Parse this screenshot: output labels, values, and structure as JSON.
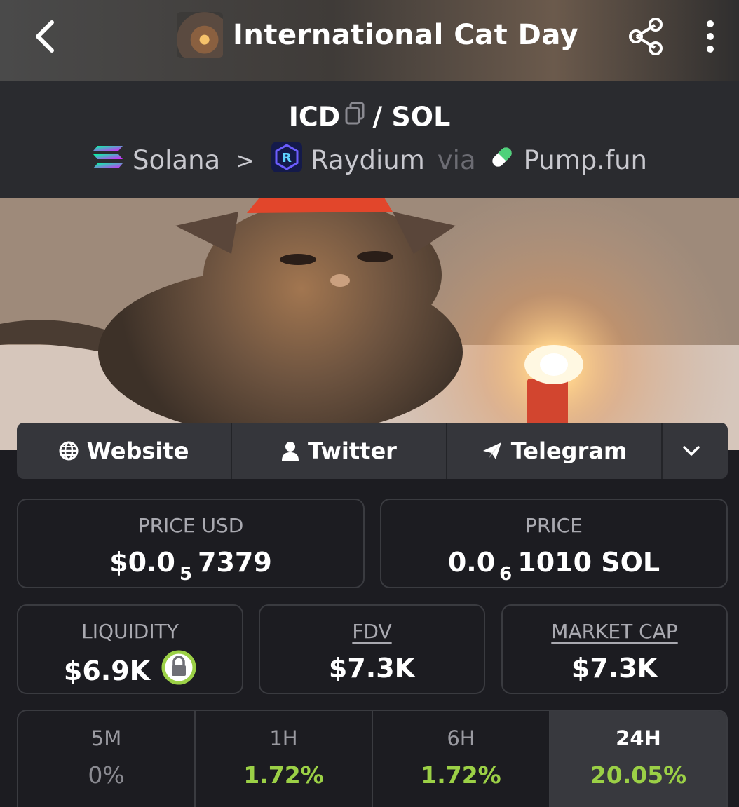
{
  "header": {
    "title": "International Cat Day",
    "icons": {
      "back": "back-chevron-icon",
      "share": "share-icon",
      "more": "more-vertical-icon"
    }
  },
  "pair": {
    "base": "ICD",
    "separator": "/",
    "quote": "SOL",
    "chain": "Solana",
    "dex": "Raydium",
    "via": "via",
    "launchpad": "Pump.fun"
  },
  "links": {
    "website": "Website",
    "twitter": "Twitter",
    "telegram": "Telegram"
  },
  "stats": {
    "price_usd": {
      "label": "PRICE USD",
      "prefix": "$0.0",
      "zeros": "5",
      "digits": "7379"
    },
    "price": {
      "label": "PRICE",
      "prefix": "0.0",
      "zeros": "6",
      "digits": "1010 SOL"
    },
    "liquidity": {
      "label": "LIQUIDITY",
      "value": "$6.9K"
    },
    "fdv": {
      "label": "FDV",
      "value": "$7.3K"
    },
    "market_cap": {
      "label": "MARKET CAP",
      "value": "$7.3K"
    }
  },
  "timeframes": [
    {
      "label": "5M",
      "value": "0%"
    },
    {
      "label": "1H",
      "value": "1.72%"
    },
    {
      "label": "6H",
      "value": "1.72%"
    },
    {
      "label": "24H",
      "value": "20.05%"
    }
  ],
  "colors": {
    "positive": "#9bd046",
    "card_border": "#3a3b40",
    "background": "#1c1c21"
  }
}
